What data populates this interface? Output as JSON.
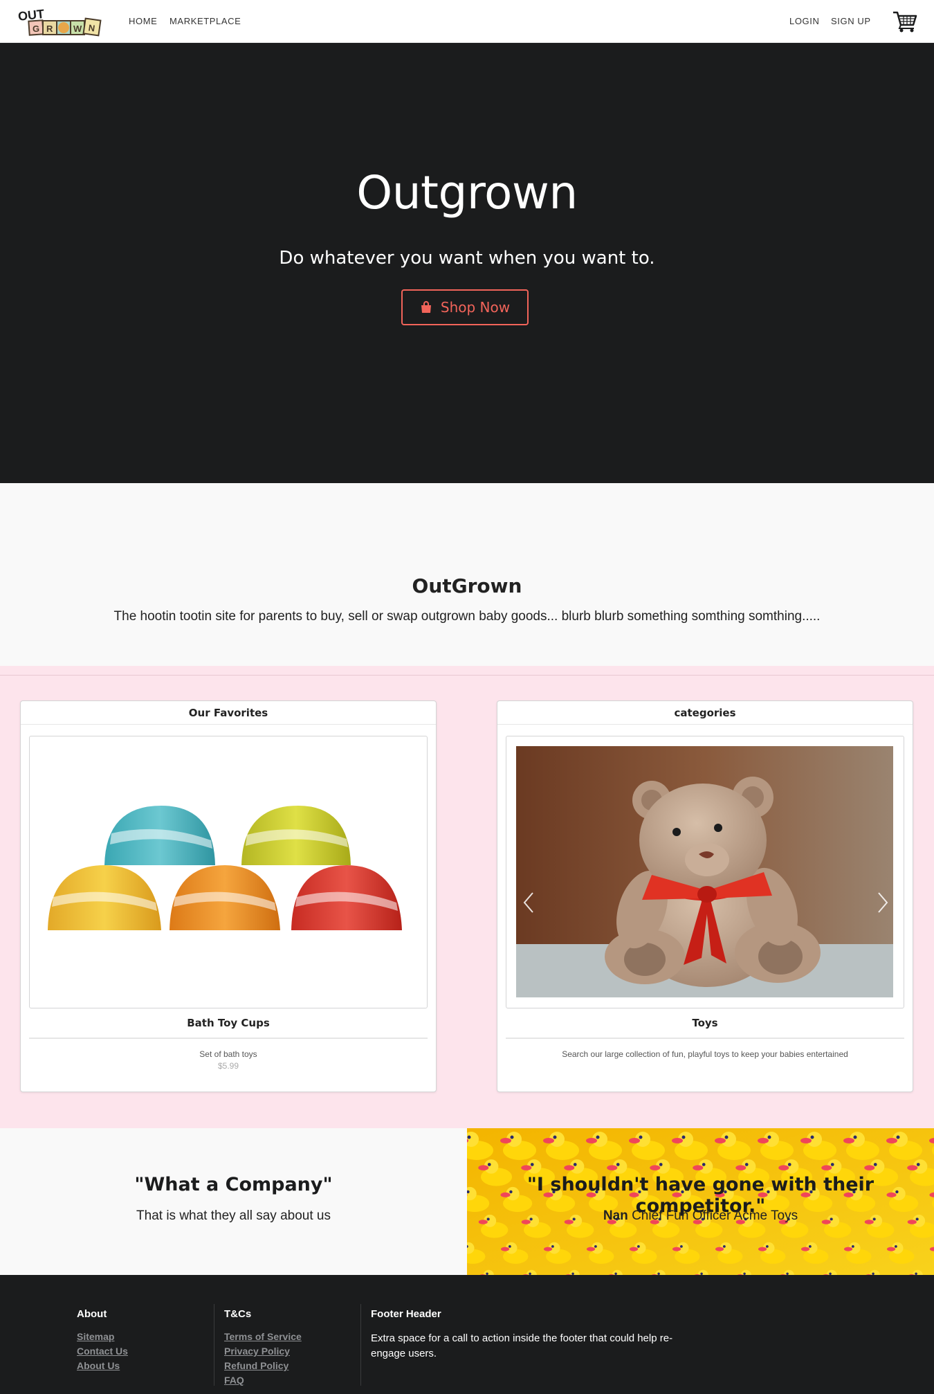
{
  "nav": {
    "links": [
      "HOME",
      "MARKETPLACE"
    ],
    "login": "LOGIN",
    "signup": "SIGN UP"
  },
  "hero": {
    "title": "Outgrown",
    "subtitle": "Do whatever you want when you want to.",
    "cta": "Shop Now"
  },
  "about": {
    "title": "OutGrown",
    "text": "The hootin tootin site for parents to buy, sell or swap outgrown baby goods... blurb blurb something somthing somthing....."
  },
  "cards": [
    {
      "header": "Our Favorites",
      "name": "Bath Toy Cups",
      "description": "Set of bath toys",
      "price": "$5.99"
    },
    {
      "header": "categories",
      "name": "Toys",
      "description": "Search our large collection of fun, playful toys to keep your babies entertained"
    }
  ],
  "testimonials": {
    "left": {
      "quote": "\"What a Company\"",
      "sub": "That is what they all say about us"
    },
    "right": {
      "quote": "\"I shouldn't have gone with their competitor.\"",
      "name": "Nan",
      "role": "Chief Fun Officer Acme Toys"
    }
  },
  "footer": {
    "about_header": "About",
    "about_links": [
      "Sitemap",
      "Contact Us",
      "About Us"
    ],
    "tcs_header": "T&Cs",
    "tcs_links": [
      "Terms of Service",
      "Privacy Policy",
      "Refund Policy",
      "FAQ"
    ],
    "cta_header": "Footer Header",
    "cta_text": "Extra space for a call to action inside the footer that could help re-engage users."
  },
  "colors": {
    "accent": "#f2645a",
    "dark": "#1b1c1d",
    "pink": "#fde4ec",
    "light": "#f9f9f9"
  }
}
